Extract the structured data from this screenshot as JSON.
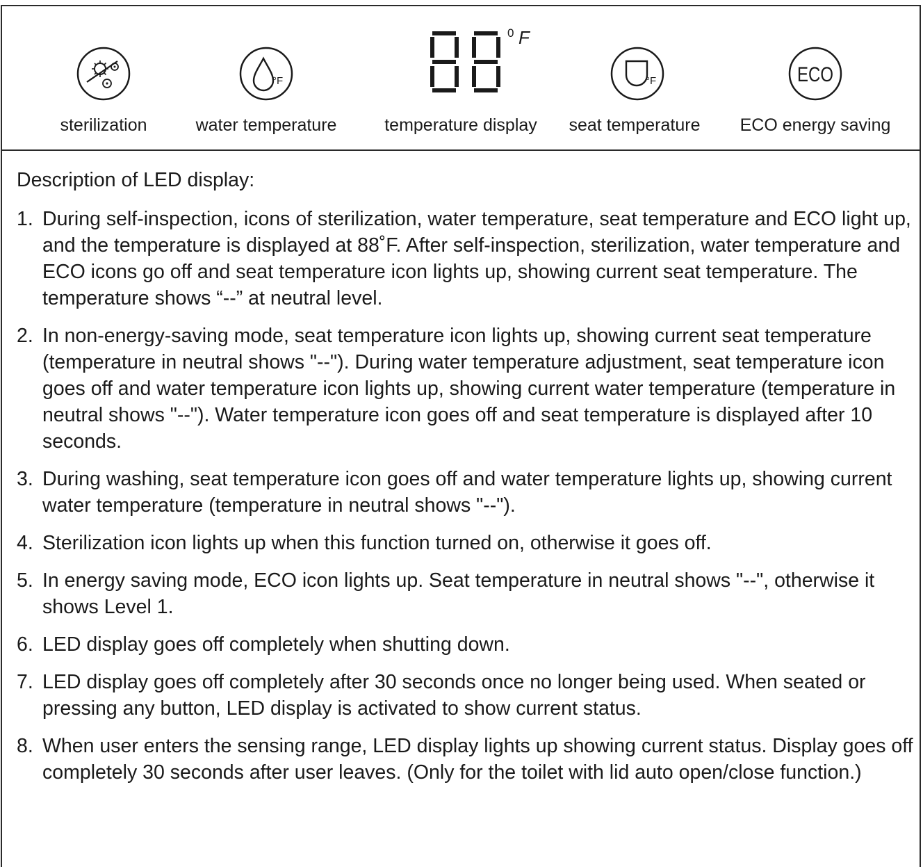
{
  "icons": [
    {
      "label": "sterilization",
      "icon": "sterilization-icon"
    },
    {
      "label": "water temperature",
      "icon": "water-drop-icon",
      "unit": "°F"
    },
    {
      "label": "temperature display",
      "icon": "seven-segment-display",
      "unit_superscript": "0",
      "unit_letter": "F"
    },
    {
      "label": "seat temperature",
      "icon": "seat-icon",
      "unit": "°F"
    },
    {
      "label": "ECO energy saving",
      "icon": "eco-icon",
      "icon_text": "ECO"
    }
  ],
  "description": {
    "title": "Description of LED display:",
    "items": [
      {
        "num": "1.",
        "text": "During self-inspection, icons of sterilization, water temperature, seat temperature and ECO light up, and the temperature is displayed at 88˚F. After self-inspection, sterilization, water temperature and ECO icons go off and seat temperature icon lights up, showing current seat temperature. The temperature shows “--” at neutral level."
      },
      {
        "num": "2.",
        "text": "In non-energy-saving mode, seat temperature icon lights up, showing current seat temperature (temperature in neutral shows \"--\"). During water temperature adjustment, seat temperature icon goes off and water temperature icon lights up, showing current water temperature (temperature in neutral shows \"--\"). Water temperature icon goes off and seat temperature is displayed after 10 seconds."
      },
      {
        "num": "3.",
        "text": "During washing, seat temperature icon goes off and water temperature lights up, showing current water temperature (temperature in neutral shows \"--\")."
      },
      {
        "num": "4.",
        "text": "Sterilization icon lights up when this function turned on, otherwise it goes off."
      },
      {
        "num": "5.",
        "text": "In energy saving mode, ECO icon lights up. Seat temperature in neutral shows \"--\", otherwise it shows Level 1."
      },
      {
        "num": "6.",
        "text": "LED display goes off completely when shutting down."
      },
      {
        "num": "7.",
        "text": "LED display goes off completely after 30 seconds once no longer being used. When seated or pressing any button, LED display is activated to show current status."
      },
      {
        "num": "8.",
        "text": "When user enters the sensing range, LED display lights up showing current status. Display goes off completely 30 seconds after user leaves. (Only for the toilet with lid auto open/close function.)"
      }
    ]
  }
}
